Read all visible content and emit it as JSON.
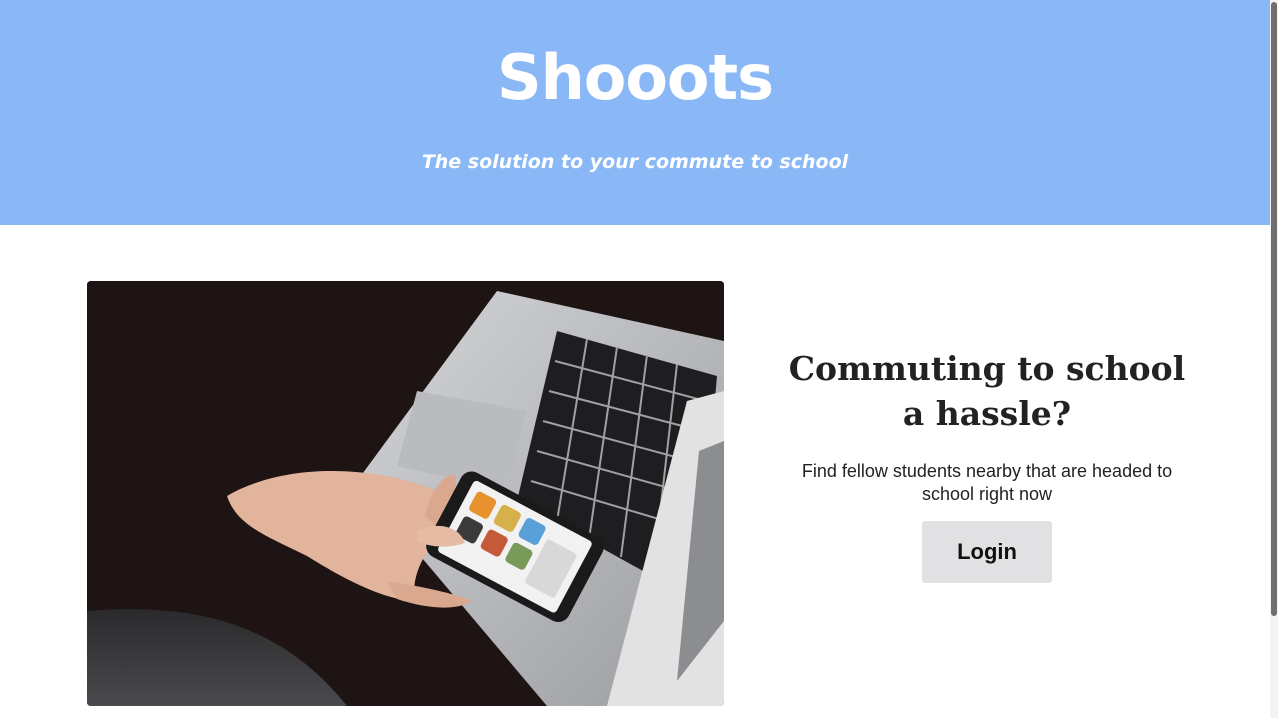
{
  "header": {
    "brand": "Shooots",
    "tagline": "The solution to your commute to school",
    "background_color": "#8ab8f7"
  },
  "hero": {
    "image_description": "hand-holding-phone-over-laptop-photo"
  },
  "promo": {
    "title": "Commuting to school a hassle?",
    "text": "Find fellow students nearby that are headed to school right now",
    "login_label": "Login",
    "button_color": "#e1e1e3"
  }
}
